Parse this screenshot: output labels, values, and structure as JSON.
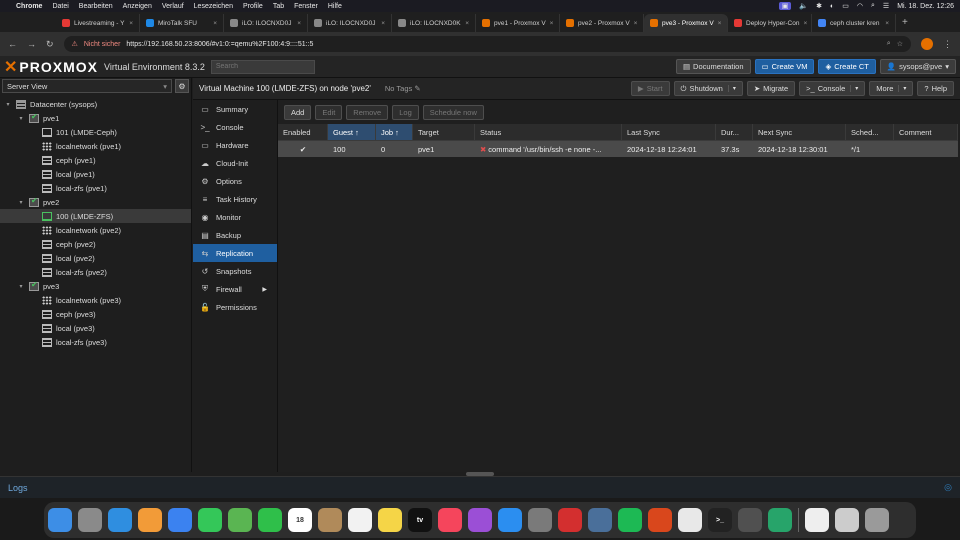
{
  "os_menubar": {
    "app": "Chrome",
    "items": [
      "Datei",
      "Bearbeiten",
      "Anzeigen",
      "Verlauf",
      "Lesezeichen",
      "Profile",
      "Tab",
      "Fenster",
      "Hilfe"
    ],
    "clock": "Mi. 18. Dez.  12:26"
  },
  "browser": {
    "tabs": [
      {
        "label": "Livestreaming - Y",
        "color": "#e53935"
      },
      {
        "label": "MiroTalk SFU",
        "color": "#1e88e5"
      },
      {
        "label": "iLO: ILOCNXD0J",
        "color": "#888888"
      },
      {
        "label": "iLO: ILOCNXD0J",
        "color": "#888888"
      },
      {
        "label": "iLO: ILOCNXD0K",
        "color": "#888888"
      },
      {
        "label": "pve1 - Proxmox V",
        "color": "#e57000"
      },
      {
        "label": "pve2 - Proxmox V",
        "color": "#e57000"
      },
      {
        "label": "pve3 - Proxmox V",
        "color": "#e57000",
        "active": true
      },
      {
        "label": "Deploy Hyper-Con",
        "color": "#e53935"
      },
      {
        "label": "ceph cluster kren",
        "color": "#4285f4"
      }
    ],
    "new_tab": "+",
    "insecure_label": "Nicht sicher",
    "url": "https://192.168.50.23:8006/#v1:0:=qemu%2F100:4:9::::51::5"
  },
  "header": {
    "logo": "PROXMOX",
    "product": "Virtual Environment 8.3.2",
    "search_placeholder": "Search",
    "buttons": {
      "documentation": "Documentation",
      "create_vm": "Create VM",
      "create_ct": "Create CT",
      "user": "sysops@pve"
    }
  },
  "left": {
    "view": "Server View",
    "tree": [
      {
        "label": "Datacenter (sysops)",
        "type": "dc",
        "level": 0,
        "caret": "▾"
      },
      {
        "label": "pve1",
        "type": "node",
        "level": 1,
        "caret": "▾"
      },
      {
        "label": "101 (LMDE-Ceph)",
        "type": "vm",
        "level": 2
      },
      {
        "label": "localnetwork (pve1)",
        "type": "net",
        "level": 2
      },
      {
        "label": "ceph (pve1)",
        "type": "sto",
        "level": 2
      },
      {
        "label": "local (pve1)",
        "type": "sto",
        "level": 2
      },
      {
        "label": "local-zfs (pve1)",
        "type": "sto",
        "level": 2
      },
      {
        "label": "pve2",
        "type": "node",
        "level": 1,
        "caret": "▾"
      },
      {
        "label": "100 (LMDE-ZFS)",
        "type": "vmrun",
        "level": 2,
        "selected": true
      },
      {
        "label": "localnetwork (pve2)",
        "type": "net",
        "level": 2
      },
      {
        "label": "ceph (pve2)",
        "type": "sto",
        "level": 2
      },
      {
        "label": "local (pve2)",
        "type": "sto",
        "level": 2
      },
      {
        "label": "local-zfs (pve2)",
        "type": "sto",
        "level": 2
      },
      {
        "label": "pve3",
        "type": "node",
        "level": 1,
        "caret": "▾"
      },
      {
        "label": "localnetwork (pve3)",
        "type": "net",
        "level": 2
      },
      {
        "label": "ceph (pve3)",
        "type": "sto",
        "level": 2
      },
      {
        "label": "local (pve3)",
        "type": "sto",
        "level": 2
      },
      {
        "label": "local-zfs (pve3)",
        "type": "sto",
        "level": 2
      }
    ]
  },
  "crumb": {
    "title": "Virtual Machine 100 (LMDE-ZFS) on node 'pve2'",
    "tags": "No Tags",
    "actions": {
      "start": "Start",
      "shutdown": "Shutdown",
      "migrate": "Migrate",
      "console": "Console",
      "more": "More",
      "help": "Help"
    }
  },
  "menu": [
    {
      "label": "Summary",
      "icon": "▭"
    },
    {
      "label": "Console",
      "icon": ">_"
    },
    {
      "label": "Hardware",
      "icon": "▭"
    },
    {
      "label": "Cloud-Init",
      "icon": "☁"
    },
    {
      "label": "Options",
      "icon": "⚙"
    },
    {
      "label": "Task History",
      "icon": "≡"
    },
    {
      "label": "Monitor",
      "icon": "◉"
    },
    {
      "label": "Backup",
      "icon": "▤"
    },
    {
      "label": "Replication",
      "icon": "⇆",
      "active": true
    },
    {
      "label": "Snapshots",
      "icon": "↺"
    },
    {
      "label": "Firewall",
      "icon": "⛨",
      "sub": "▶"
    },
    {
      "label": "Permissions",
      "icon": "🔓"
    }
  ],
  "toolbar": {
    "add": "Add",
    "edit": "Edit",
    "remove": "Remove",
    "log": "Log",
    "schedule": "Schedule now"
  },
  "grid": {
    "columns": [
      "Enabled",
      "Guest ↑",
      "Job ↑",
      "Target",
      "Status",
      "Last Sync",
      "Dur...",
      "Next Sync",
      "Sched...",
      "Comment"
    ],
    "rows": [
      {
        "enabled": "✔",
        "guest": "100",
        "job": "0",
        "target": "pve1",
        "status": "command '/usr/bin/ssh -e none -...",
        "last_sync": "2024-12-18 12:24:01",
        "duration": "37.3s",
        "next_sync": "2024-12-18 12:30:01",
        "schedule": "*/1",
        "comment": ""
      }
    ]
  },
  "logs": {
    "label": "Logs"
  },
  "dock": [
    {
      "name": "finder-icon",
      "color": "#3d8ee6"
    },
    {
      "name": "launchpad-icon",
      "color": "#8a8a8a"
    },
    {
      "name": "safari-icon",
      "color": "#2f8ee0"
    },
    {
      "name": "photos-icon",
      "color": "#f29b38"
    },
    {
      "name": "mail-icon",
      "color": "#3b82f0"
    },
    {
      "name": "messages-icon",
      "color": "#34c759"
    },
    {
      "name": "maps-icon",
      "color": "#5ab552"
    },
    {
      "name": "facetime-icon",
      "color": "#2fbf4a"
    },
    {
      "name": "calendar-icon",
      "color": "#ffffff",
      "text": "18"
    },
    {
      "name": "contacts-icon",
      "color": "#b08a5a"
    },
    {
      "name": "reminders-icon",
      "color": "#f2f2f2"
    },
    {
      "name": "notes-icon",
      "color": "#f5d547"
    },
    {
      "name": "appletv-icon",
      "color": "#111111",
      "text": "tv"
    },
    {
      "name": "music-icon",
      "color": "#f5455c"
    },
    {
      "name": "podcasts-icon",
      "color": "#9b4fd6"
    },
    {
      "name": "appstore-icon",
      "color": "#2b8ef0"
    },
    {
      "name": "system-settings-icon",
      "color": "#7a7a7a"
    },
    {
      "name": "app-red-icon",
      "color": "#d32f2f"
    },
    {
      "name": "app-globe-icon",
      "color": "#4a6f9a"
    },
    {
      "name": "spotify-icon",
      "color": "#1db954"
    },
    {
      "name": "app-orange-icon",
      "color": "#d9471c"
    },
    {
      "name": "chrome-icon",
      "color": "#e8e8e8"
    },
    {
      "name": "terminal-icon",
      "color": "#222222",
      "text": ">_"
    },
    {
      "name": "calculator-icon",
      "color": "#505050"
    },
    {
      "name": "app-green-icon",
      "color": "#27a46a"
    },
    {
      "name": "document-icon",
      "color": "#eeeeee"
    },
    {
      "name": "printer-icon",
      "color": "#cccccc"
    },
    {
      "name": "trash-icon",
      "color": "#9a9a9a"
    }
  ]
}
